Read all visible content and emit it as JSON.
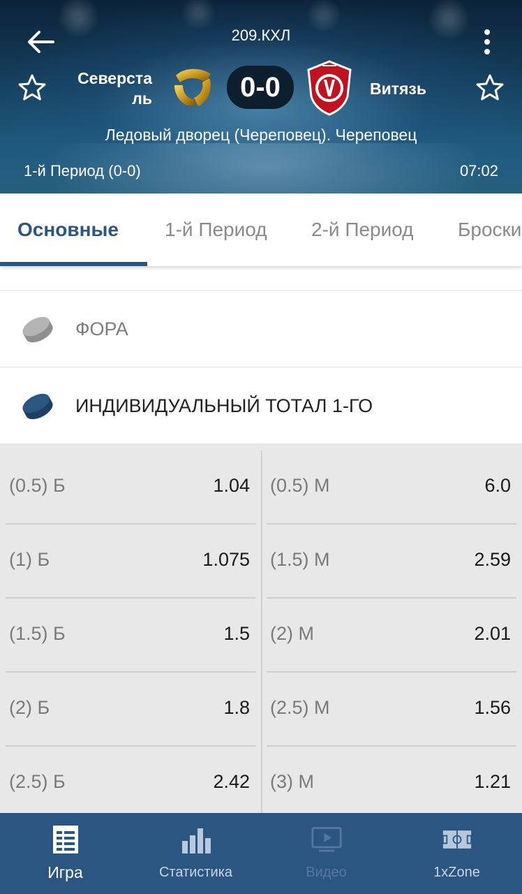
{
  "header": {
    "title": "209.КХЛ",
    "home_team": "Северсталь",
    "home_team_line1": "Северста",
    "home_team_line2": "ль",
    "away_team": "Витязь",
    "score": "0-0",
    "venue": "Ледовый дворец (Череповец). Череповец",
    "period": "1-й  Период (0-0)",
    "clock": "07:02",
    "icons": {
      "back": "arrow-left-icon",
      "more": "more-vertical-icon",
      "favorite": "star-outline-icon",
      "home_logo": "severstal-logo",
      "away_logo": "vityaz-logo"
    }
  },
  "tabs": [
    {
      "label": "Основные",
      "active": true
    },
    {
      "label": "1-й  Период",
      "active": false
    },
    {
      "label": "2-й  Период",
      "active": false
    },
    {
      "label": "Броски",
      "active": false
    }
  ],
  "groups": [
    {
      "label": "ФОРА",
      "icon": "hockey-puck-icon",
      "expanded": false
    },
    {
      "label": "ИНДИВИДУАЛЬНЫЙ ТОТАЛ 1-ГО",
      "icon": "hockey-puck-icon",
      "expanded": true
    }
  ],
  "odds": [
    {
      "left": {
        "label": "(0.5) Б",
        "value": "1.04"
      },
      "right": {
        "label": "(0.5) М",
        "value": "6.0"
      }
    },
    {
      "left": {
        "label": "(1) Б",
        "value": "1.075"
      },
      "right": {
        "label": "(1.5) М",
        "value": "2.59"
      }
    },
    {
      "left": {
        "label": "(1.5) Б",
        "value": "1.5"
      },
      "right": {
        "label": "(2) М",
        "value": "2.01"
      }
    },
    {
      "left": {
        "label": "(2) Б",
        "value": "1.8"
      },
      "right": {
        "label": "(2.5) М",
        "value": "1.56"
      }
    },
    {
      "left": {
        "label": "(2.5) Б",
        "value": "2.42"
      },
      "right": {
        "label": "(3) М",
        "value": "1.21"
      }
    }
  ],
  "bottom_nav": [
    {
      "label": "Игра",
      "icon": "game-list-icon",
      "state": "active"
    },
    {
      "label": "Статистика",
      "icon": "bar-chart-icon",
      "state": "normal"
    },
    {
      "label": "Видео",
      "icon": "video-screen-icon",
      "state": "disabled"
    },
    {
      "label": "1xZone",
      "icon": "field-zone-icon",
      "state": "normal"
    }
  ],
  "colors": {
    "brand": "#2a5681",
    "active_tab": "#2a5681",
    "odds_bg": "#e8e8e8",
    "puck_active": "#2a5681",
    "puck_inactive": "#a5a5a5"
  }
}
